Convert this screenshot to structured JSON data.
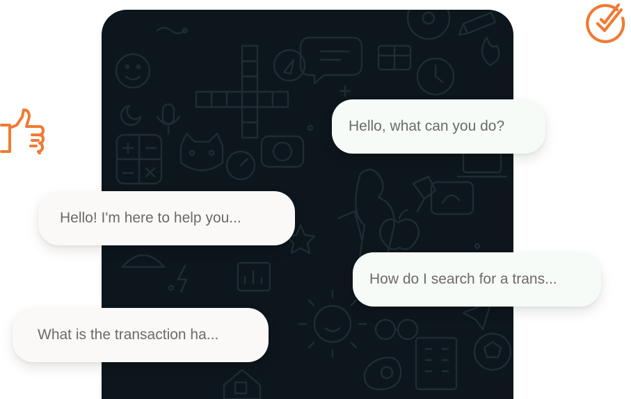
{
  "colors": {
    "panel_background": "#0d161c",
    "pattern_stroke": "#1f2c33",
    "bubble_incoming": "#faf9f7",
    "bubble_outgoing": "#f7fbf8",
    "bubble_text": "#6c6a67",
    "accent_orange": "#f07a32"
  },
  "icons": {
    "badge": "check-badge-icon",
    "reaction": "thumbs-up-icon"
  },
  "messages": [
    {
      "id": "msg-1",
      "direction": "outgoing",
      "text": "Hello, what can you do?"
    },
    {
      "id": "msg-2",
      "direction": "incoming",
      "text": "Hello! I'm here to help you..."
    },
    {
      "id": "msg-3",
      "direction": "outgoing",
      "text": "How do I search for a trans..."
    },
    {
      "id": "msg-4",
      "direction": "incoming",
      "text": "What is the transaction ha..."
    }
  ]
}
